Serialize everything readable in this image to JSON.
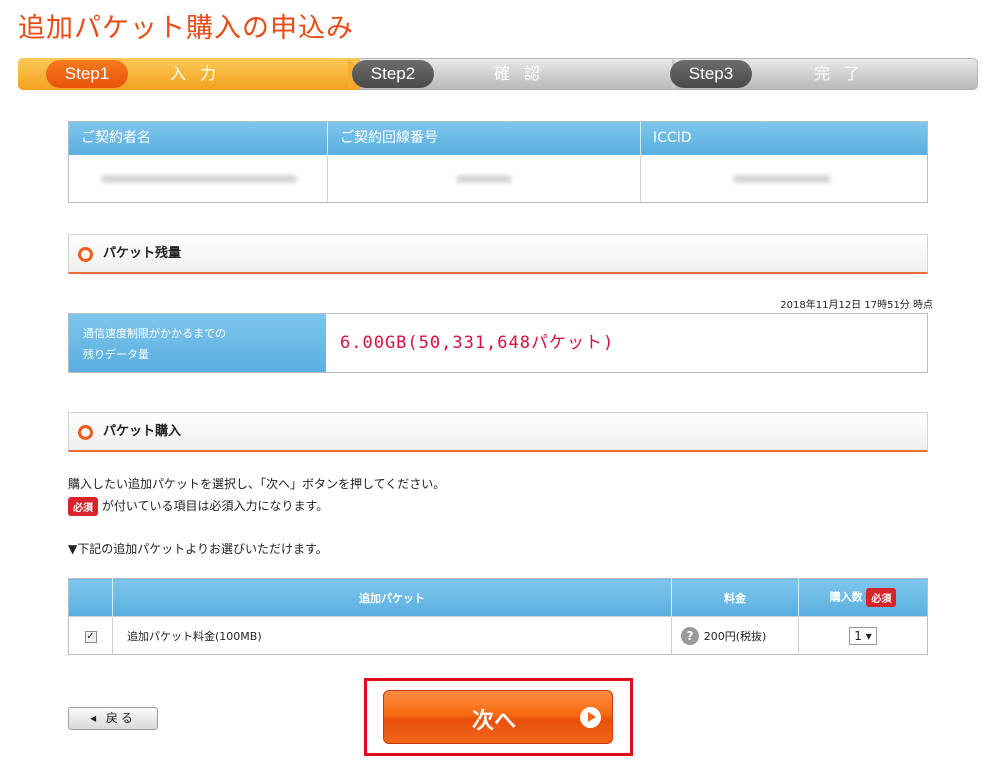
{
  "page": {
    "title": "追加パケット購入の申込み"
  },
  "steps": [
    {
      "pill": "Step1",
      "label": "入力",
      "active": true
    },
    {
      "pill": "Step2",
      "label": "確認",
      "active": false
    },
    {
      "pill": "Step3",
      "label": "完了",
      "active": false
    }
  ],
  "contract": {
    "headers": [
      "ご契約者名",
      "ご契約回線番号",
      "ICCID"
    ]
  },
  "sections": {
    "remaining_title": "パケット残量",
    "purchase_title": "パケット購入"
  },
  "remaining": {
    "timestamp": "2018年11月12日 17時51分 時点",
    "label_line1": "通信速度制限がかかるまでの",
    "label_line2": "残りデータ量",
    "value": "6.00GB(50,331,648パケット)"
  },
  "instructions": {
    "line1": "購入したい追加パケットを選択し、「次へ」ボタンを押してください。",
    "required_badge": "必須",
    "line2": "が付いている項目は必須入力になります。",
    "line3": "▼下記の追加パケットよりお選びいただけます。"
  },
  "purchase_table": {
    "headers": {
      "item": "追加パケット",
      "price": "料金",
      "qty": "購入数"
    },
    "row": {
      "checked": true,
      "item": "追加パケット料金(100MB)",
      "price": "200円(税抜)",
      "qty": "1"
    }
  },
  "buttons": {
    "back": "戻る",
    "next": "次へ"
  },
  "colors": {
    "accent": "#ea4b16",
    "header_blue": "#5aaee0",
    "value_red": "#d6103f"
  }
}
